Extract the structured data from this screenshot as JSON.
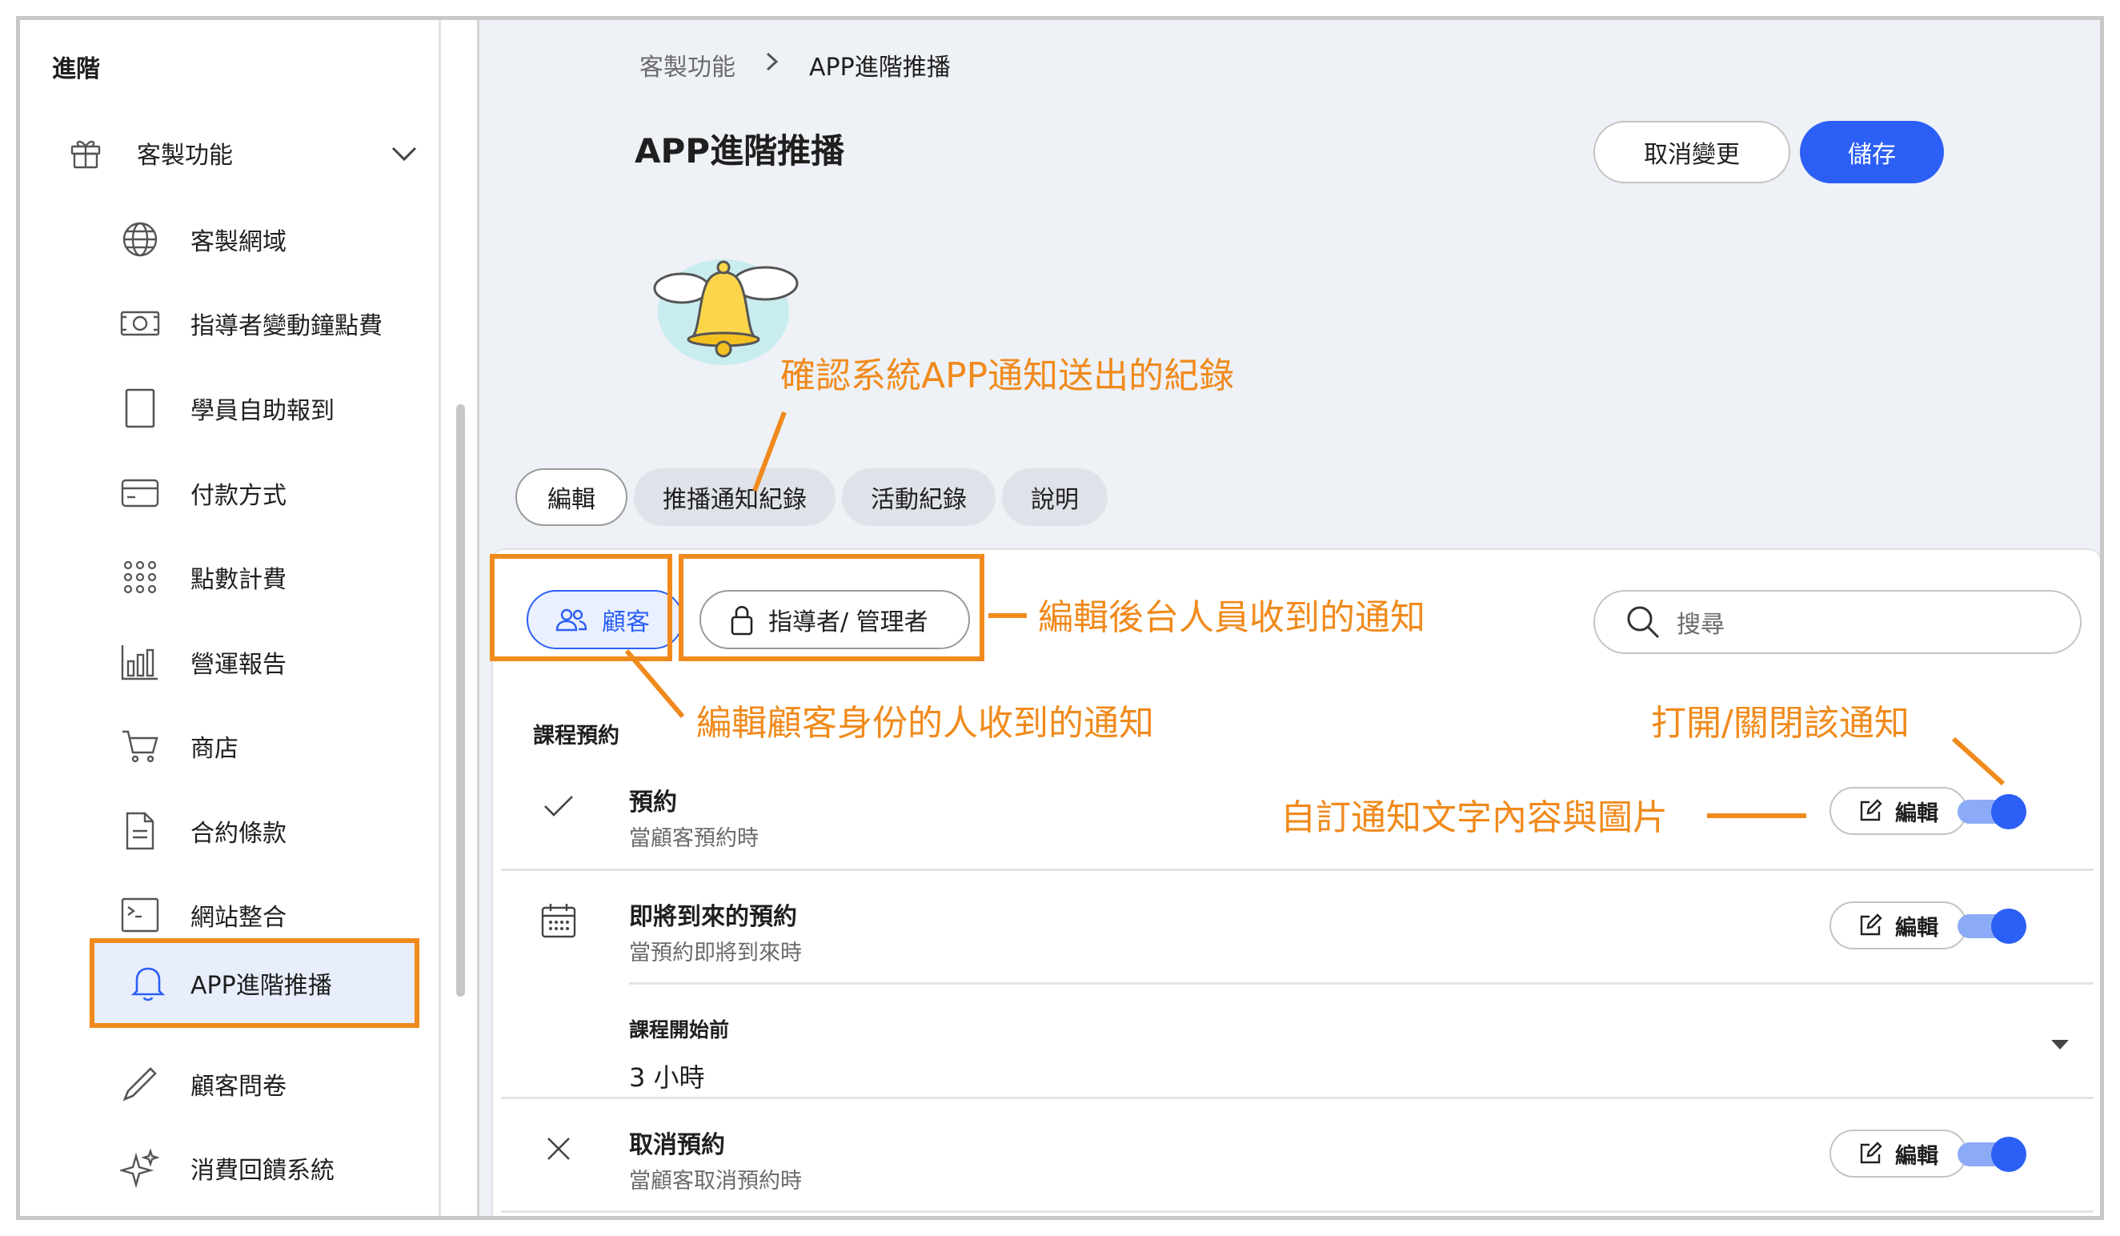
{
  "sidebar": {
    "heading": "進階",
    "group": {
      "label": "客製功能",
      "icon": "gift-icon",
      "expanded": true
    },
    "items": [
      {
        "label": "客製網域",
        "icon": "globe-icon"
      },
      {
        "label": "指導者變動鐘點費",
        "icon": "money-icon"
      },
      {
        "label": "學員自助報到",
        "icon": "tablet-icon"
      },
      {
        "label": "付款方式",
        "icon": "credit-card-icon"
      },
      {
        "label": "點數計費",
        "icon": "dots-grid-icon"
      },
      {
        "label": "營運報告",
        "icon": "bar-chart-icon"
      },
      {
        "label": "商店",
        "icon": "cart-icon"
      },
      {
        "label": "合約條款",
        "icon": "document-icon"
      },
      {
        "label": "網站整合",
        "icon": "terminal-icon"
      },
      {
        "label": "APP進階推播",
        "icon": "bell-icon",
        "active": true
      },
      {
        "label": "顧客問卷",
        "icon": "pencil-icon"
      },
      {
        "label": "消費回饋系統",
        "icon": "sparkle-icon"
      }
    ]
  },
  "breadcrumb": {
    "parent": "客製功能",
    "separator": ">",
    "current": "APP進階推播"
  },
  "header": {
    "title": "APP進階推播",
    "cancel_label": "取消變更",
    "save_label": "儲存"
  },
  "tabs": [
    "編輯",
    "推播通知紀錄",
    "活動紀錄",
    "說明"
  ],
  "active_tab": 0,
  "roles": {
    "customer_label": "顧客",
    "staff_label": "指導者/ 管理者"
  },
  "search": {
    "placeholder": "搜尋"
  },
  "section": {
    "label": "課程預約"
  },
  "notifications": [
    {
      "title": "預約",
      "subtitle": "當顧客預約時",
      "icon": "check-icon",
      "edit_label": "編輯",
      "enabled": true
    },
    {
      "title": "即將到來的預約",
      "subtitle": "當預約即將到來時",
      "icon": "calendar-icon",
      "edit_label": "編輯",
      "enabled": true
    },
    {
      "title": "取消預約",
      "subtitle": "當顧客取消預約時",
      "icon": "x-icon",
      "edit_label": "編輯",
      "enabled": true
    }
  ],
  "sub_setting": {
    "label": "課程開始前",
    "value": "3 小時"
  },
  "annotations": {
    "log": "確認系統APP通知送出的紀錄",
    "staff": "編輯後台人員收到的通知",
    "customer": "編輯顧客身份的人收到的通知",
    "toggle": "打開/關閉該通知",
    "custom": "自訂通知文字內容與圖片"
  },
  "colors": {
    "accent": "#2c5ff5",
    "annotation": "#f08a1c",
    "active_bg": "#e8eefc",
    "main_bg": "#eef1f6"
  }
}
